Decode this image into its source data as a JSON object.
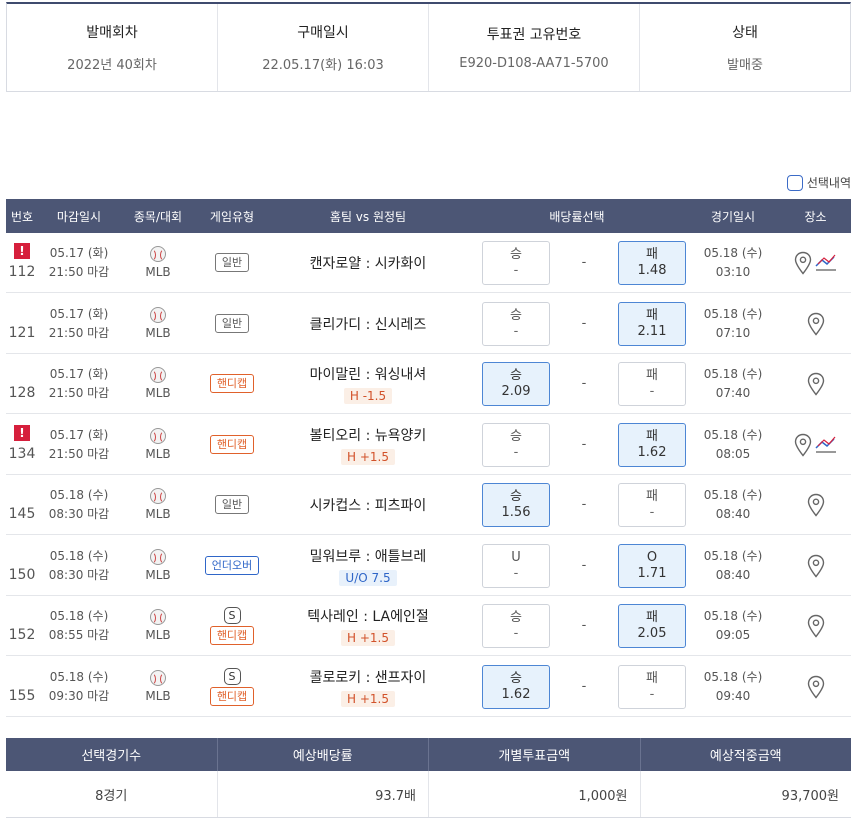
{
  "info": {
    "round_label": "발매회차",
    "round_value": "2022년 40회차",
    "buy_label": "구매일시",
    "buy_value": "22.05.17(화) 16:03",
    "ticket_label": "투표권 고유번호",
    "ticket_value": "E920-D108-AA71-5700",
    "status_label": "상태",
    "status_value": "발매중"
  },
  "select_toggle": "선택내역",
  "table": {
    "headers": {
      "no": "번호",
      "deadline": "마감일시",
      "sport": "종목/대회",
      "type": "게임유형",
      "match": "홈팀 vs 원정팀",
      "odds": "배당률선택",
      "date": "경기일시",
      "place": "장소"
    },
    "rows": [
      {
        "no": "112",
        "alert": "!",
        "dl_date": "05.17 (화)",
        "dl_time": "21:50 마감",
        "league": "MLB",
        "type": "일반",
        "type_kind": "normal",
        "s": "",
        "match": "캔자로얄 : 시카화이",
        "hcap": "",
        "left_label": "승",
        "left_val": "-",
        "left_sel": false,
        "mid": "-",
        "right_label": "패",
        "right_val": "1.48",
        "right_sel": true,
        "g_date": "05.18 (수)",
        "g_time": "03:10",
        "trend": true
      },
      {
        "no": "121",
        "alert": "",
        "dl_date": "05.17 (화)",
        "dl_time": "21:50 마감",
        "league": "MLB",
        "type": "일반",
        "type_kind": "normal",
        "s": "",
        "match": "클리가디 : 신시레즈",
        "hcap": "",
        "left_label": "승",
        "left_val": "-",
        "left_sel": false,
        "mid": "-",
        "right_label": "패",
        "right_val": "2.11",
        "right_sel": true,
        "g_date": "05.18 (수)",
        "g_time": "07:10",
        "trend": false
      },
      {
        "no": "128",
        "alert": "",
        "dl_date": "05.17 (화)",
        "dl_time": "21:50 마감",
        "league": "MLB",
        "type": "핸디캡",
        "type_kind": "hc",
        "s": "",
        "match": "마이말린 : 워싱내셔",
        "hcap": "H -1.5",
        "left_label": "승",
        "left_val": "2.09",
        "left_sel": true,
        "mid": "-",
        "right_label": "패",
        "right_val": "-",
        "right_sel": false,
        "g_date": "05.18 (수)",
        "g_time": "07:40",
        "trend": false
      },
      {
        "no": "134",
        "alert": "!",
        "dl_date": "05.17 (화)",
        "dl_time": "21:50 마감",
        "league": "MLB",
        "type": "핸디캡",
        "type_kind": "hc",
        "s": "",
        "match": "볼티오리 : 뉴욕양키",
        "hcap": "H +1.5",
        "left_label": "승",
        "left_val": "-",
        "left_sel": false,
        "mid": "-",
        "right_label": "패",
        "right_val": "1.62",
        "right_sel": true,
        "g_date": "05.18 (수)",
        "g_time": "08:05",
        "trend": true
      },
      {
        "no": "145",
        "alert": "",
        "dl_date": "05.18 (수)",
        "dl_time": "08:30 마감",
        "league": "MLB",
        "type": "일반",
        "type_kind": "normal",
        "s": "",
        "match": "시카컵스 : 피츠파이",
        "hcap": "",
        "left_label": "승",
        "left_val": "1.56",
        "left_sel": true,
        "mid": "-",
        "right_label": "패",
        "right_val": "-",
        "right_sel": false,
        "g_date": "05.18 (수)",
        "g_time": "08:40",
        "trend": false
      },
      {
        "no": "150",
        "alert": "",
        "dl_date": "05.18 (수)",
        "dl_time": "08:30 마감",
        "league": "MLB",
        "type": "언더오버",
        "type_kind": "ou",
        "s": "",
        "match": "밀워브루 : 애틀브레",
        "hcap": "U/O 7.5",
        "left_label": "U",
        "left_val": "-",
        "left_sel": false,
        "mid": "-",
        "right_label": "O",
        "right_val": "1.71",
        "right_sel": true,
        "g_date": "05.18 (수)",
        "g_time": "08:40",
        "trend": false
      },
      {
        "no": "152",
        "alert": "",
        "dl_date": "05.18 (수)",
        "dl_time": "08:55 마감",
        "league": "MLB",
        "type": "핸디캡",
        "type_kind": "hc",
        "s": "S",
        "match": "텍사레인 : LA에인절",
        "hcap": "H +1.5",
        "left_label": "승",
        "left_val": "-",
        "left_sel": false,
        "mid": "-",
        "right_label": "패",
        "right_val": "2.05",
        "right_sel": true,
        "g_date": "05.18 (수)",
        "g_time": "09:05",
        "trend": false
      },
      {
        "no": "155",
        "alert": "",
        "dl_date": "05.18 (수)",
        "dl_time": "09:30 마감",
        "league": "MLB",
        "type": "핸디캡",
        "type_kind": "hc",
        "s": "S",
        "match": "콜로로키 : 샌프자이",
        "hcap": "H +1.5",
        "left_label": "승",
        "left_val": "1.62",
        "left_sel": true,
        "mid": "-",
        "right_label": "패",
        "right_val": "-",
        "right_sel": false,
        "g_date": "05.18 (수)",
        "g_time": "09:40",
        "trend": false
      }
    ]
  },
  "summary": {
    "headers": {
      "count": "선택경기수",
      "odds": "예상배당률",
      "amount": "개별투표금액",
      "payout": "예상적중금액"
    },
    "values": {
      "count": "8경기",
      "odds": "93.7배",
      "amount": "1,000원",
      "payout": "93,700원"
    }
  }
}
